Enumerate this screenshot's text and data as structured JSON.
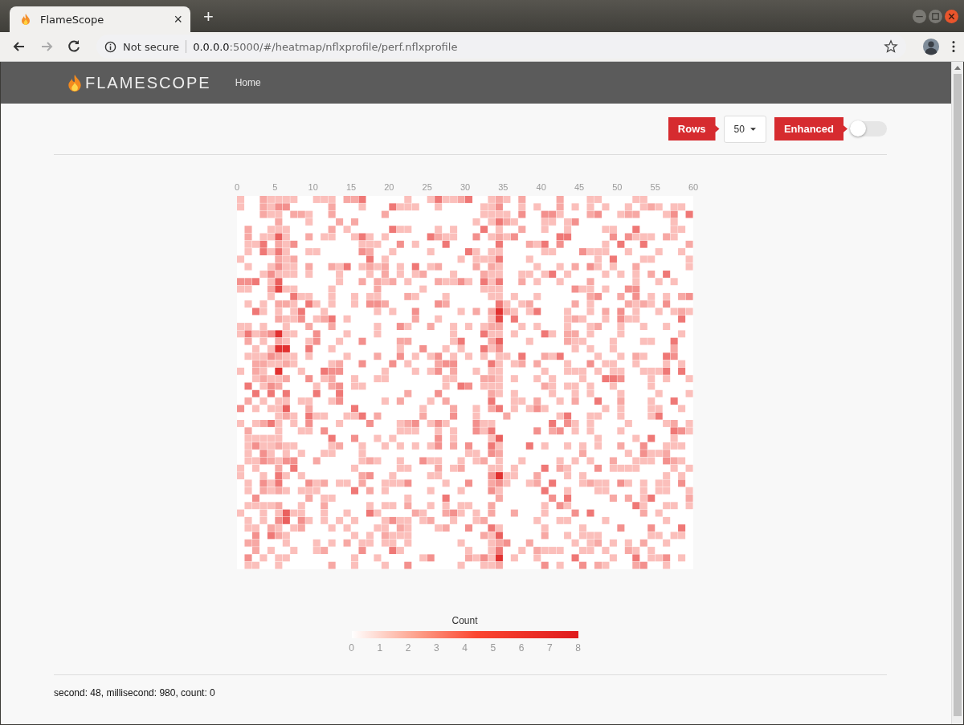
{
  "browser": {
    "tab_title": "FlameScope",
    "tab_close": "×",
    "new_tab": "+",
    "security": "Not secure",
    "url_host": "0.0.0.0",
    "url_rest": ":5000/#/heatmap/nflxprofile/perf.nflxprofile"
  },
  "navbar": {
    "brand": "FLAMESCOPE",
    "links": [
      {
        "label": "Home"
      }
    ]
  },
  "controls": {
    "rows_label": "Rows",
    "rows_value": "50",
    "enhanced_label": "Enhanced",
    "enhanced_on": false
  },
  "heatmap": {
    "x_ticks": [
      "0",
      "5",
      "10",
      "15",
      "20",
      "25",
      "30",
      "35",
      "40",
      "45",
      "50",
      "55",
      "60"
    ]
  },
  "legend": {
    "title": "Count",
    "ticks": [
      "0",
      "1",
      "2",
      "3",
      "4",
      "5",
      "6",
      "7",
      "8"
    ]
  },
  "status": "second: 48, millisecond: 980, count: 0"
}
